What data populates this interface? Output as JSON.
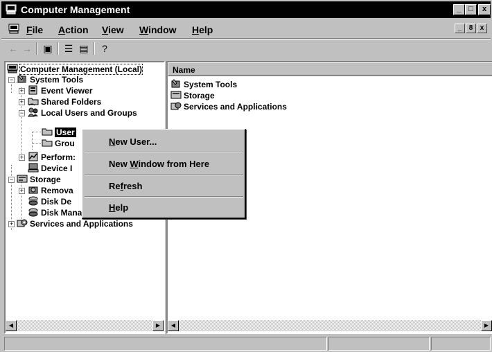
{
  "window": {
    "title": "Computer Management",
    "min": "_",
    "max": "□",
    "close": "x"
  },
  "menu": {
    "items": [
      {
        "pre": "",
        "ul": "F",
        "post": "ile"
      },
      {
        "pre": "",
        "ul": "A",
        "post": "ction"
      },
      {
        "pre": "",
        "ul": "V",
        "post": "iew"
      },
      {
        "pre": "",
        "ul": "W",
        "post": "indow"
      },
      {
        "pre": "",
        "ul": "H",
        "post": "elp"
      }
    ],
    "doc_min": "_",
    "doc_restore": "8",
    "doc_close": "x"
  },
  "toolbar": {
    "back": "←",
    "forward": "→",
    "show_hide": "▣",
    "properties": "☰",
    "export": "▤",
    "help": "?"
  },
  "tree": {
    "root": "Computer Management (Local)",
    "system_tools": "System Tools",
    "event_viewer": "Event Viewer",
    "shared_folders": "Shared Folders",
    "local_users": "Local Users and Groups",
    "users": "User",
    "groups": "Grou",
    "performance": "Perform:",
    "device_manager": "Device I",
    "storage": "Storage",
    "removable": "Remova",
    "disk_defrag": "Disk De",
    "disk_mgmt": "Disk Management",
    "services": "Services and Applications",
    "plus": "+",
    "minus": "−"
  },
  "list": {
    "column_name": "Name",
    "rows": [
      "System Tools",
      "Storage",
      "Services and Applications"
    ]
  },
  "context_menu": {
    "new_user": {
      "pre": "",
      "ul": "N",
      "post": "ew User..."
    },
    "new_window": {
      "pre": "New ",
      "ul": "W",
      "post": "indow from Here"
    },
    "refresh": {
      "pre": "Re",
      "ul": "f",
      "post": "resh"
    },
    "help": {
      "pre": "",
      "ul": "H",
      "post": "elp"
    }
  },
  "scroll": {
    "left": "◀",
    "right": "▶"
  },
  "colors": {
    "titlebar": "#000000",
    "face": "#c0c0c0",
    "pane": "#ffffff",
    "selection": "#000000"
  },
  "icons": [
    "computer-icon",
    "tools-icon",
    "event-log-icon",
    "shared-folder-icon",
    "users-groups-icon",
    "folder-icon",
    "performance-icon",
    "device-icon",
    "storage-icon",
    "removable-storage-icon",
    "defrag-icon",
    "disk-icon",
    "services-icon"
  ]
}
